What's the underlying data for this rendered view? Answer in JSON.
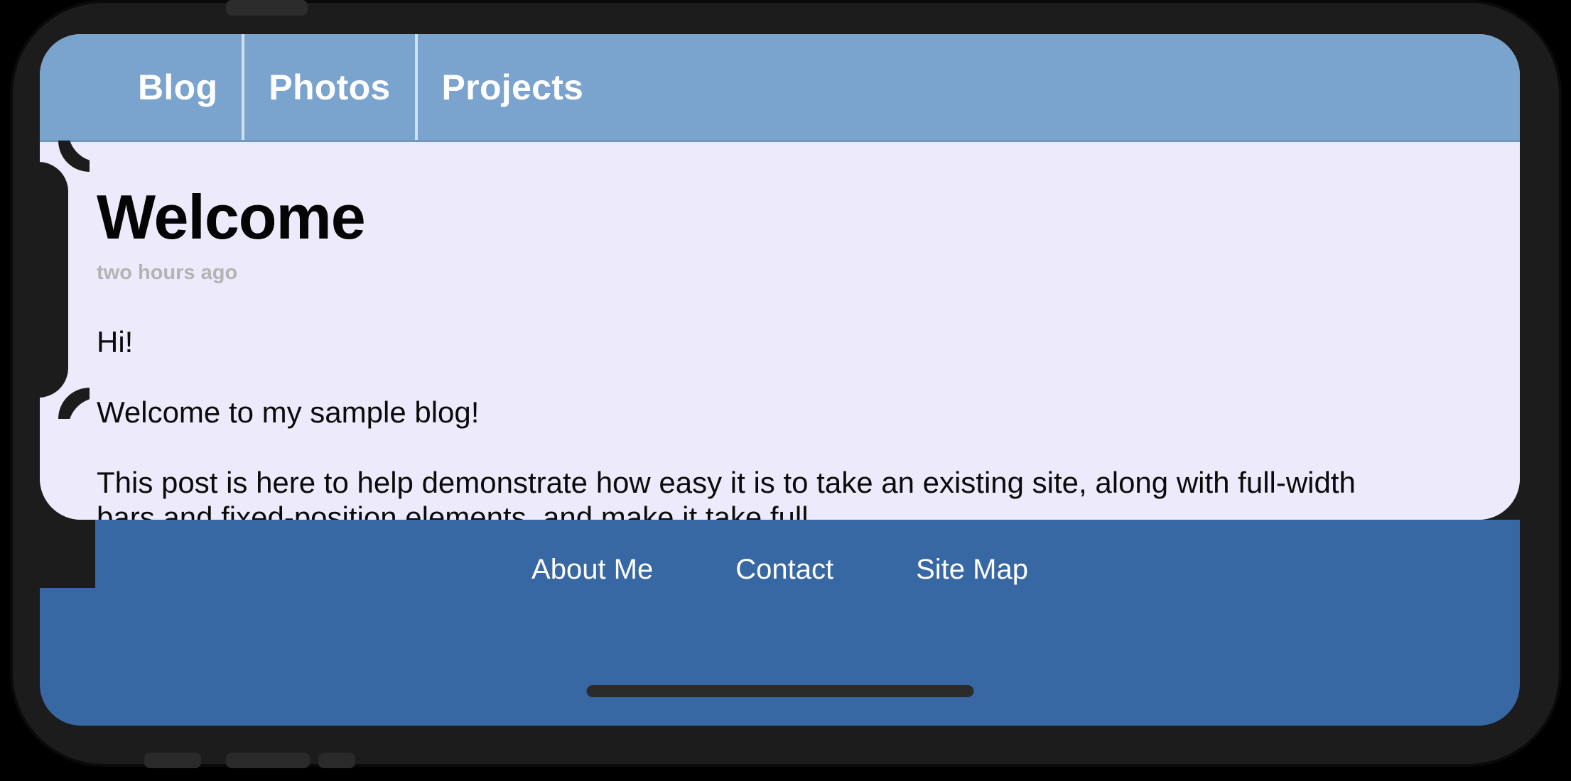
{
  "device": {
    "type": "phone-mockup-landscape",
    "notch_side": "left",
    "home_indicator": "home-indicator-bar"
  },
  "nav": {
    "tabs": [
      {
        "label": "Blog",
        "name": "nav-tab-blog"
      },
      {
        "label": "Photos",
        "name": "nav-tab-photos"
      },
      {
        "label": "Projects",
        "name": "nav-tab-projects"
      }
    ],
    "background_color": "#7aa3ce",
    "text_color": "#ffffff",
    "separator_color": "#cfe0f0"
  },
  "post": {
    "title": "Welcome",
    "timestamp": "two hours ago",
    "paragraphs": [
      "Hi!",
      "Welcome to my sample blog!",
      "This post is here to help demonstrate how easy it is to take an existing site, along with full-width bars and fixed-position elements, and make it take full"
    ]
  },
  "footer": {
    "links": [
      {
        "label": "About Me",
        "name": "footer-link-about-me"
      },
      {
        "label": "Contact",
        "name": "footer-link-contact"
      },
      {
        "label": "Site Map",
        "name": "footer-link-site-map"
      }
    ],
    "background_color": "#3868a4",
    "text_color": "#ffffff"
  },
  "colors": {
    "page_background": "#edebfb",
    "device_body": "#1c1c1c",
    "outer_background": "#000000",
    "title_color": "#050505",
    "timestamp_color": "#b3b3b3"
  }
}
